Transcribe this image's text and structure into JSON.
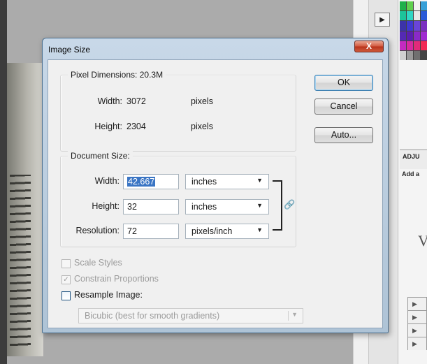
{
  "dialog": {
    "title": "Image Size",
    "close_label": "X",
    "buttons": {
      "ok": "OK",
      "cancel": "Cancel",
      "auto": "Auto..."
    },
    "pixel_dimensions": {
      "legend": "Pixel Dimensions:",
      "size": "20.3M",
      "width_label": "Width:",
      "width_value": "3072",
      "width_unit": "pixels",
      "height_label": "Height:",
      "height_value": "2304",
      "height_unit": "pixels"
    },
    "document_size": {
      "legend": "Document Size:",
      "width_label": "Width:",
      "width_value": "42.667",
      "width_unit": "inches",
      "height_label": "Height:",
      "height_value": "32",
      "height_unit": "inches",
      "resolution_label": "Resolution:",
      "resolution_value": "72",
      "resolution_unit": "pixels/inch"
    },
    "options": {
      "scale_styles": {
        "label": "Scale Styles",
        "checked": false,
        "enabled": false
      },
      "constrain_proportions": {
        "label": "Constrain Proportions",
        "checked": true,
        "enabled": false
      },
      "resample_image": {
        "label": "Resample Image:",
        "checked": false,
        "enabled": true
      },
      "resample_method": "Bicubic (best for smooth gradients)"
    }
  },
  "background": {
    "panel_header": "ADJU",
    "panel_add": "Add a",
    "panel_glyph": "V"
  },
  "colors": {
    "selection": "#3a75c4",
    "title_bar": "#b9cde0",
    "close_button": "#c8462b",
    "swatches": [
      "#1fb04a",
      "#5fd04f",
      "#f2f2f2",
      "#37a0d8",
      "#1dc39a",
      "#2fd6c4",
      "#e8e8e8",
      "#2b5bd8",
      "#3c33a8",
      "#3f38d0",
      "#6a44d8",
      "#7a2fc0",
      "#542ab3",
      "#5b1fb0",
      "#8a2ac8",
      "#a02ad0",
      "#c32bc0",
      "#d62aa0",
      "#e22a7a",
      "#f02a55",
      "#d0d0d0",
      "#9a9a9a",
      "#707070",
      "#444444"
    ]
  }
}
